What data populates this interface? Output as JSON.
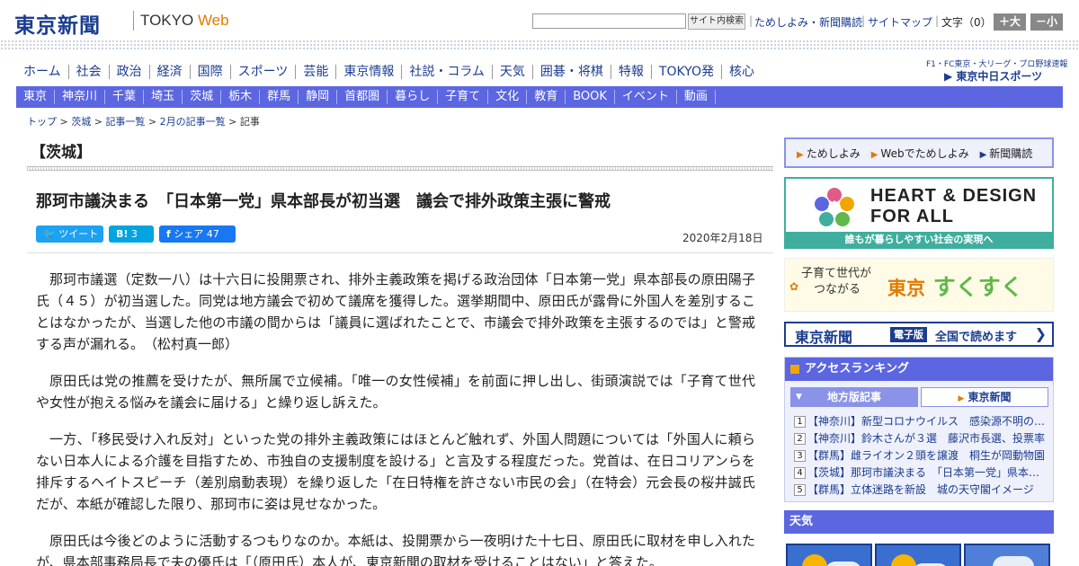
{
  "header": {
    "logo": "東京新聞",
    "logo_tokyo": "TOKYO",
    "logo_web": "Web",
    "search_button": "サイト内検索",
    "links": [
      "ためしよみ・新聞購読",
      "サイトマップ"
    ],
    "font_size_label": "文字（0）",
    "font_plus": "＋大",
    "font_minus": "－小"
  },
  "nav_main": [
    "ホーム",
    "社会",
    "政治",
    "経済",
    "国際",
    "スポーツ",
    "芸能",
    "東京情報",
    "社説・コラム",
    "天気",
    "囲碁・将棋",
    "特報",
    "TOKYO発",
    "核心"
  ],
  "chunichi": {
    "line1": "F1・FC東京・大リーグ・プロ野球速報",
    "line2": "東京中日スポーツ"
  },
  "nav_region": [
    "東京",
    "神奈川",
    "千葉",
    "埼玉",
    "茨城",
    "栃木",
    "群馬",
    "静岡",
    "首都圏",
    "暮らし",
    "子育て",
    "文化",
    "教育",
    "BOOK",
    "イベント",
    "動画"
  ],
  "breadcrumb": {
    "items": [
      "トップ",
      "茨城",
      "記事一覧",
      "2月の記事一覧"
    ],
    "current": "記事",
    "sep": " > "
  },
  "article": {
    "category": "【茨城】",
    "headline": "那珂市議決まる　「日本第一党」県本部長が初当選　議会で排外政策主張に警戒",
    "share": {
      "tweet": "ツイート",
      "hatena_label": "B!",
      "hatena_count": "3",
      "facebook_label": "シェア",
      "facebook_count": "47"
    },
    "date": "2020年2月18日",
    "paragraphs": [
      "那珂市議選（定数一八）は十六日に投開票され、排外主義政策を掲げる政治団体「日本第一党」県本部長の原田陽子氏（４５）が初当選した。同党は地方議会で初めて議席を獲得した。選挙期間中、原田氏が露骨に外国人を差別することはなかったが、当選した他の市議の間からは「議員に選ばれたことで、市議会で排外政策を主張するのでは」と警戒する声が漏れる。　（松村真一郎）",
      "原田氏は党の推薦を受けたが、無所属で立候補。「唯一の女性候補」を前面に押し出し、街頭演説では「子育て世代や女性が抱える悩みを議会に届ける」と繰り返し訴えた。",
      "一方、「移民受け入れ反対」といった党の排外主義政策にはほとんど触れず、外国人問題については「外国人に頼らない日本人による介護を目指すため、市独自の支援制度を設ける」と言及する程度だった。党首は、在日コリアンらを排斥するヘイトスピーチ（差別扇動表現）を繰り返した「在日特権を許さない市民の会」（在特会）元会長の桜井誠氏だが、本紙が確認した限り、那珂市に姿は見せなかった。",
      "原田氏は今後どのように活動するつもりなのか。本紙は、投開票から一夜明けた十七日、原田氏に取材を申し入れたが、県本部事務局長で夫の優氏は「（原田氏）本人が、東京新聞の取材を受けることはない」と答えた。"
    ]
  },
  "sidebar": {
    "links": [
      "ためしよみ",
      "Webでためしよみ",
      "新聞購読"
    ],
    "heart_design": {
      "line1": "HEART & DESIGN",
      "line2": "FOR ALL",
      "bar": "誰もが暮らしやすい社会の実現へ"
    },
    "sukusuku": {
      "small1": "子育て世代が",
      "small2": "つながる",
      "tokyo": "東京",
      "big": "すくすく"
    },
    "denshi": {
      "logo": "東京新聞",
      "badge": "電子版",
      "text": "全国で読めます"
    },
    "ranking": {
      "title": "アクセスランキング",
      "tab_local": "地方版記事",
      "tab_tokyo": "東京新聞",
      "items": [
        "【神奈川】新型コロナウイルス　感染源不明の市内男性",
        "【神奈川】鈴木さんが３選　藤沢市長選、投票率",
        "【群馬】雌ライオン２頭を譲渡　桐生が岡動物園",
        "【茨城】那珂市議決まる　「日本第一党」県本部長",
        "【群馬】立体迷路を新設　城の天守閣イメージ"
      ]
    },
    "weather_title": "天気"
  }
}
